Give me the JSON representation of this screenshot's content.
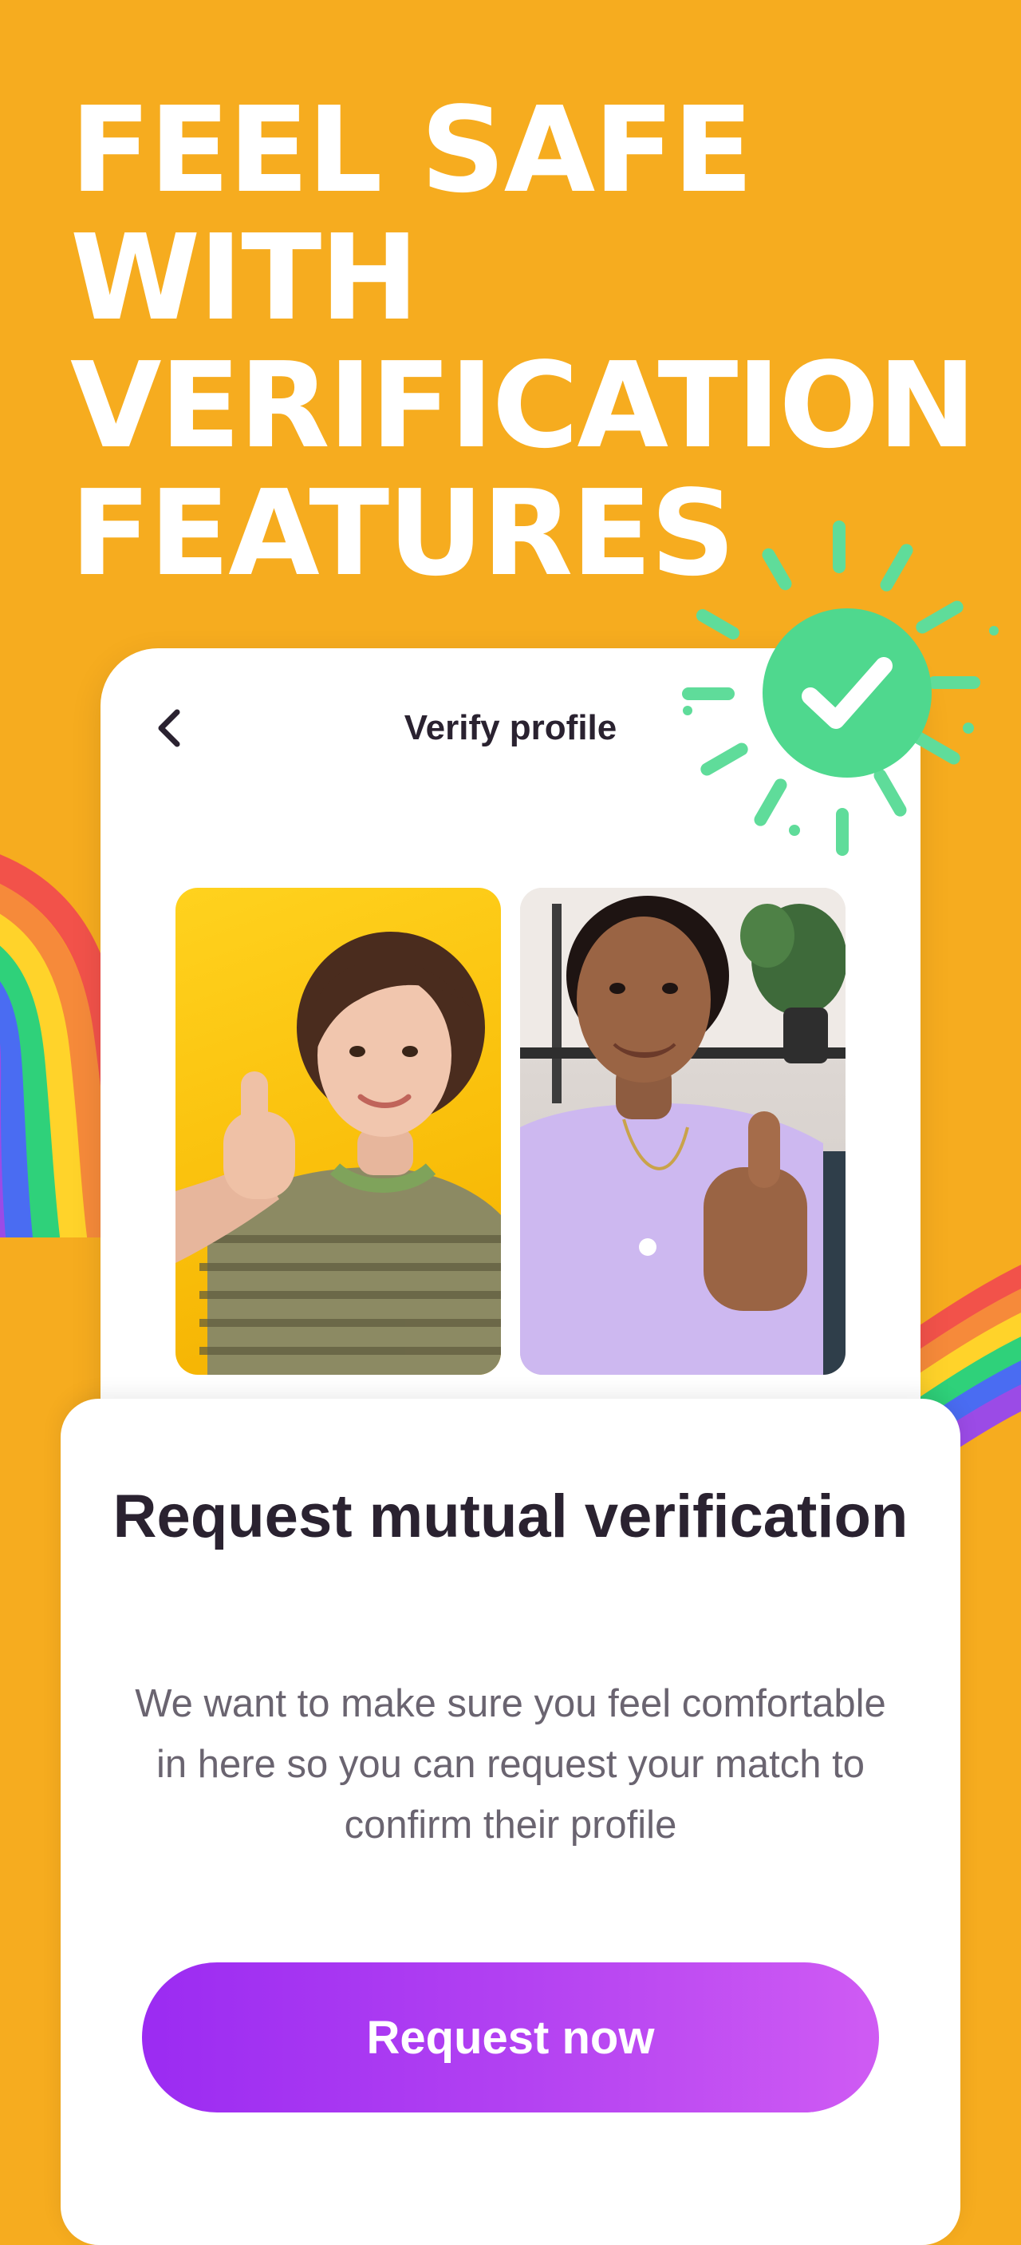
{
  "headline": {
    "lines": [
      "FEEL SAFE",
      "WITH",
      "VERIFICATION",
      "FEATURES"
    ]
  },
  "verify_screen": {
    "title": "Verify profile",
    "back_icon": "chevron-left-icon",
    "photos": [
      {
        "name": "profile-photo-user",
        "shirt": "striped"
      },
      {
        "name": "profile-photo-match",
        "shirt": "lavender"
      }
    ]
  },
  "badge": {
    "icon": "verified-check-icon",
    "color": "#4FD88E"
  },
  "sheet": {
    "title": "Request mutual verification",
    "body": "We want to make sure you feel comfortable in here so you can request your match to confirm their profile",
    "cta_label": "Request now"
  },
  "colors": {
    "background": "#F6AC1F",
    "cta_start": "#9B2BF2",
    "cta_end": "#CF5BF3",
    "check_green": "#4FD88E"
  }
}
